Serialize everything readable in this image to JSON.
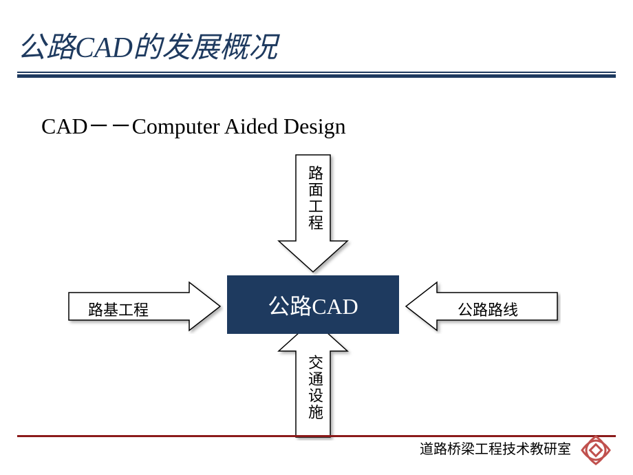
{
  "title": "公路CAD的发展概况",
  "subtitle": "CAD－－Computer Aided Design",
  "center": "公路CAD",
  "arrows": {
    "top": "路面工程",
    "left": "路基工程",
    "right": "公路路线",
    "bottom": "交通设施"
  },
  "footer": "道路桥梁工程技术教研室",
  "colors": {
    "primary": "#1e3a5f",
    "accent": "#8b1a1a",
    "logoAccent": "#c0504d"
  }
}
